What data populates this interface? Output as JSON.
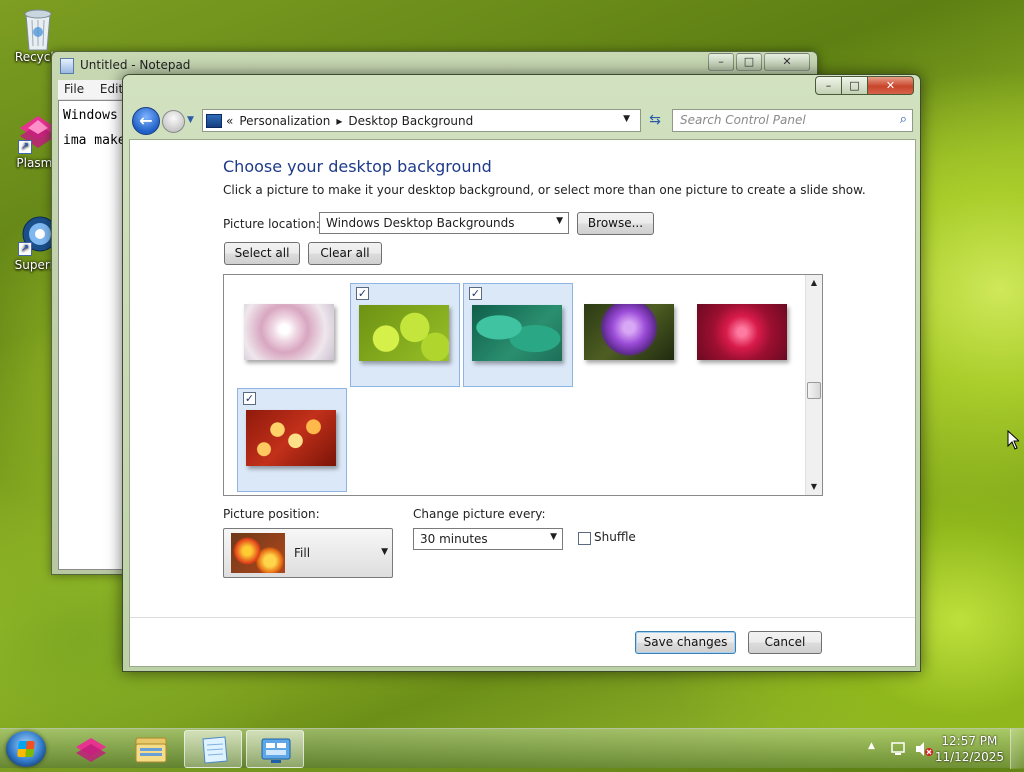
{
  "desktop": {
    "icons": [
      {
        "label": "Recycle"
      },
      {
        "label": "Plasma"
      },
      {
        "label": "Superm"
      }
    ]
  },
  "notepad": {
    "title": "Untitled - Notepad",
    "menu": [
      "File",
      "Edit"
    ],
    "lines": [
      "Windows",
      "ima make"
    ]
  },
  "control_panel": {
    "breadcrumb": [
      "Personalization",
      "Desktop Background"
    ],
    "breadcrumb_prefix": "«",
    "search_placeholder": "Search Control Panel",
    "heading": "Choose your desktop background",
    "subtext": "Click a picture to make it your desktop background, or select more than one picture to create a slide show.",
    "picture_location_label": "Picture location:",
    "picture_location_value": "Windows Desktop Backgrounds",
    "browse_label": "Browse...",
    "select_all_label": "Select all",
    "clear_all_label": "Clear all",
    "thumbnails": [
      {
        "name": "white-flower",
        "selected": false
      },
      {
        "name": "green-bubbles",
        "selected": true
      },
      {
        "name": "green-leaves",
        "selected": true
      },
      {
        "name": "purple-thistle",
        "selected": false
      },
      {
        "name": "red-dahlia",
        "selected": false
      },
      {
        "name": "autumn-leaves",
        "selected": true
      }
    ],
    "picture_position_label": "Picture position:",
    "picture_position_value": "Fill",
    "change_every_label": "Change picture every:",
    "change_every_value": "30 minutes",
    "shuffle_label": "Shuffle",
    "shuffle_checked": false,
    "save_label": "Save changes",
    "cancel_label": "Cancel"
  },
  "taskbar": {
    "time": "12:57 PM",
    "date": "11/12/2025"
  },
  "colors": {
    "heading": "#1e3a8a",
    "selection": "#dbe8f8"
  }
}
